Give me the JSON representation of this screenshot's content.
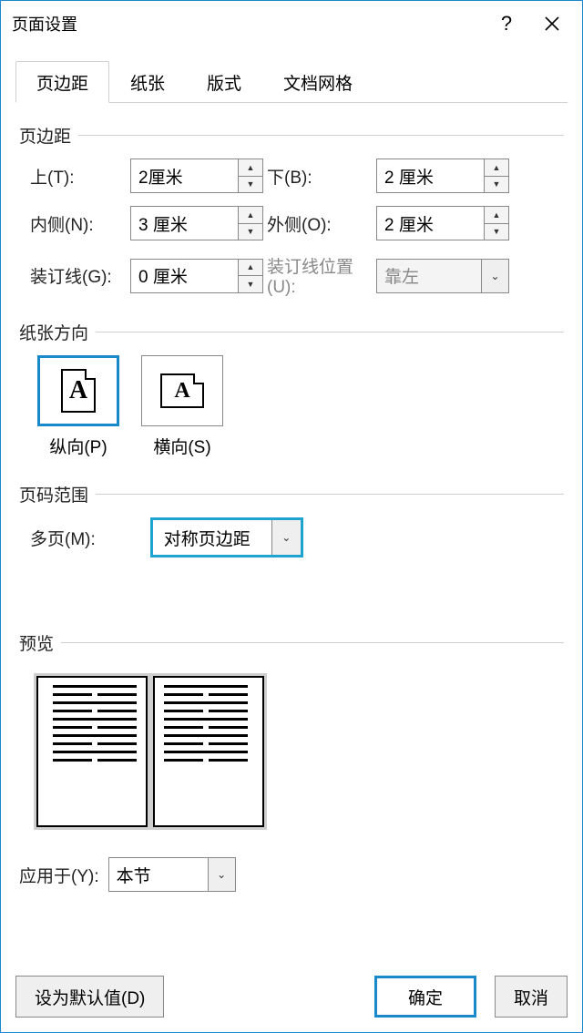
{
  "window": {
    "title": "页面设置"
  },
  "tabs": [
    "页边距",
    "纸张",
    "版式",
    "文档网格"
  ],
  "sections": {
    "margins": "页边距",
    "orientation": "纸张方向",
    "range": "页码范围",
    "preview": "预览"
  },
  "margins": {
    "top_label": "上(T):",
    "top_value": "2厘米",
    "bottom_label": "下(B):",
    "bottom_value": "2 厘米",
    "inside_label": "内侧(N):",
    "inside_value": "3 厘米",
    "outside_label": "外侧(O):",
    "outside_value": "2 厘米",
    "gutter_label": "装订线(G):",
    "gutter_value": "0 厘米",
    "gutter_pos_label": "装订线位置(U):",
    "gutter_pos_value": "靠左"
  },
  "orientation": {
    "portrait": "纵向(P)",
    "landscape": "横向(S)"
  },
  "multipage": {
    "label": "多页(M):",
    "value": "对称页边距"
  },
  "apply": {
    "label": "应用于(Y):",
    "value": "本节"
  },
  "buttons": {
    "default": "设为默认值(D)",
    "ok": "确定",
    "cancel": "取消"
  }
}
